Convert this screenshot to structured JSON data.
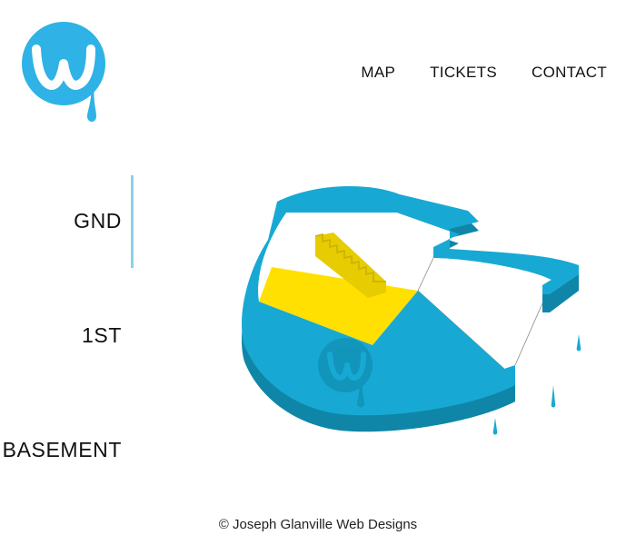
{
  "nav": {
    "items": [
      "MAP",
      "TICKETS",
      "CONTACT"
    ]
  },
  "floors": {
    "items": [
      "GND",
      "1ST",
      "BASEMENT"
    ],
    "selected": "GND"
  },
  "footer": {
    "text": "© Joseph Glanville Web Designs"
  },
  "colors": {
    "brand": "#2fb2e6",
    "map_wall": "#17a9d3",
    "map_wall_side": "#0f86a8",
    "highlight": "#ffe000",
    "stairs": "#e6cc00",
    "indicator": "#8fd0ea"
  },
  "icons": {
    "logo": "w-droplet-logo-icon",
    "map_watermark": "w-droplet-logo-icon",
    "drips": "water-drop-icon"
  }
}
